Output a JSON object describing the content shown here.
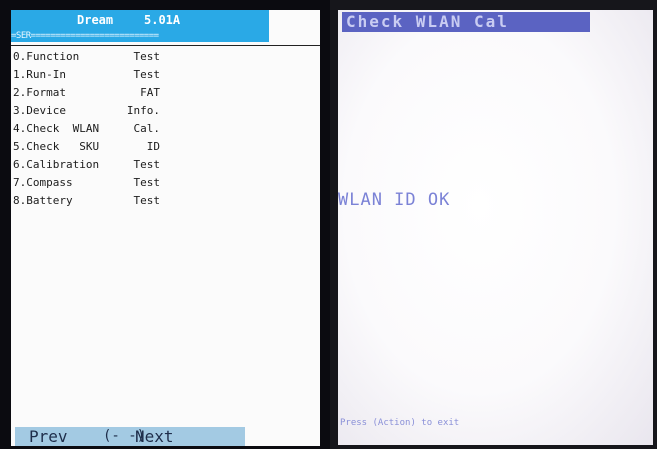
{
  "left_screen": {
    "title": "Dream",
    "version": "5.01A",
    "separator": "=SER==========================",
    "menu": [
      {
        "label": "0.Function",
        "value": "Test"
      },
      {
        "label": "1.Run-In",
        "value": "Test"
      },
      {
        "label": "2.Format",
        "value": "FAT"
      },
      {
        "label": "3.Device",
        "value": "Info."
      },
      {
        "label": "4.Check  WLAN",
        "value": "Cal."
      },
      {
        "label": "5.Check   SKU",
        "value": "ID"
      },
      {
        "label": "6.Calibration",
        "value": "Test"
      },
      {
        "label": "7.Compass",
        "value": "Test"
      },
      {
        "label": "8.Battery",
        "value": "Test"
      }
    ],
    "nav": {
      "prev": "Prev",
      "arrows": "(-  -)",
      "next": "Next"
    }
  },
  "right_screen": {
    "header": "Check WLAN Cal",
    "message": "WLAN ID OK",
    "hint": "Press (Action) to exit"
  },
  "colors": {
    "title_bar": "#2aa9e6",
    "nav_bar": "#a3cae3",
    "check_header": "#5b63c2",
    "status_text": "#7b82d6"
  }
}
